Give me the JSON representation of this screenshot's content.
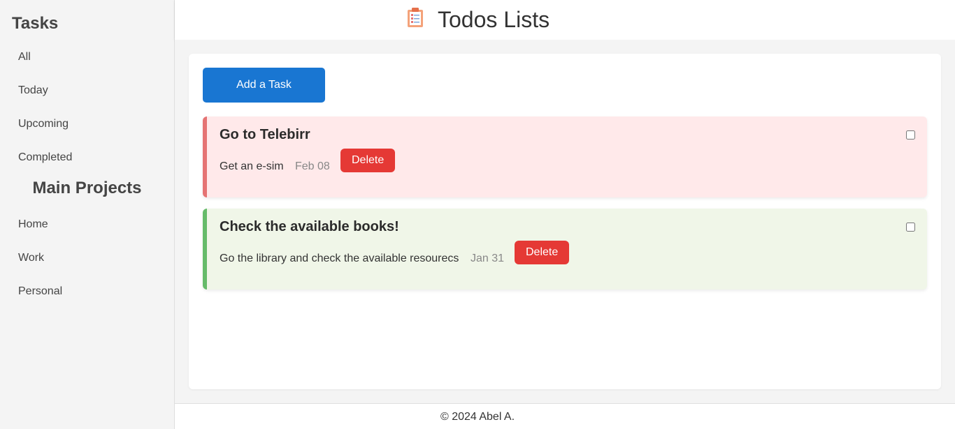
{
  "sidebar": {
    "heading": "Tasks",
    "task_items": [
      {
        "label": "All"
      },
      {
        "label": "Today"
      },
      {
        "label": "Upcoming"
      },
      {
        "label": "Completed"
      }
    ],
    "projects_heading": "Main Projects",
    "project_items": [
      {
        "label": "Home"
      },
      {
        "label": "Work"
      },
      {
        "label": "Personal"
      }
    ]
  },
  "header": {
    "icon": "clipboard-icon",
    "title": "Todos Lists"
  },
  "main": {
    "add_button_label": "Add a Task",
    "tasks": [
      {
        "title": "Go to Telebirr",
        "description": "Get an e-sim",
        "date": "Feb 08",
        "delete_label": "Delete",
        "checked": false,
        "accent_color": "#e57373",
        "background_color": "#ffe9ea"
      },
      {
        "title": "Check the available books!",
        "description": "Go the library and check the available resourecs",
        "date": "Jan 31",
        "delete_label": "Delete",
        "checked": false,
        "accent_color": "#66bb6a",
        "background_color": "#f0f6e8"
      }
    ]
  },
  "footer": {
    "text": "© 2024 Abel A."
  },
  "colors": {
    "primary_button": "#1976d2",
    "delete_button": "#e53935"
  }
}
